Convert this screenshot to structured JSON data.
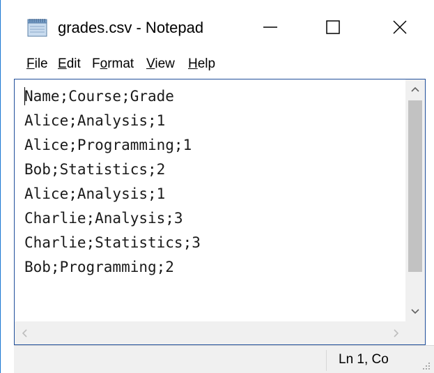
{
  "window": {
    "title": "grades.csv - Notepad",
    "icon": "notepad-icon"
  },
  "controls": {
    "minimize_icon": "minimize-icon",
    "maximize_icon": "maximize-icon",
    "close_icon": "close-icon"
  },
  "menu": {
    "items": [
      {
        "label": "File",
        "accel": "F",
        "rest": "ile"
      },
      {
        "label": "Edit",
        "accel": "E",
        "rest": "dit"
      },
      {
        "label": "Format",
        "pre": "F",
        "accel": "o",
        "rest": "rmat"
      },
      {
        "label": "View",
        "accel": "V",
        "rest": "iew"
      },
      {
        "label": "Help",
        "accel": "H",
        "rest": "elp"
      }
    ]
  },
  "editor": {
    "lines": [
      "Name;Course;Grade",
      "Alice;Analysis;1",
      "Alice;Programming;1",
      "Bob;Statistics;2",
      "Alice;Analysis;1",
      "Charlie;Analysis;3",
      "Charlie;Statistics;3",
      "Bob;Programming;2"
    ]
  },
  "status": {
    "position": "Ln 1, Co"
  },
  "colors": {
    "border_accent": "#1a76d2",
    "scrollbar_bg": "#f0f0f0",
    "scroll_thumb": "#c2c2c2"
  }
}
